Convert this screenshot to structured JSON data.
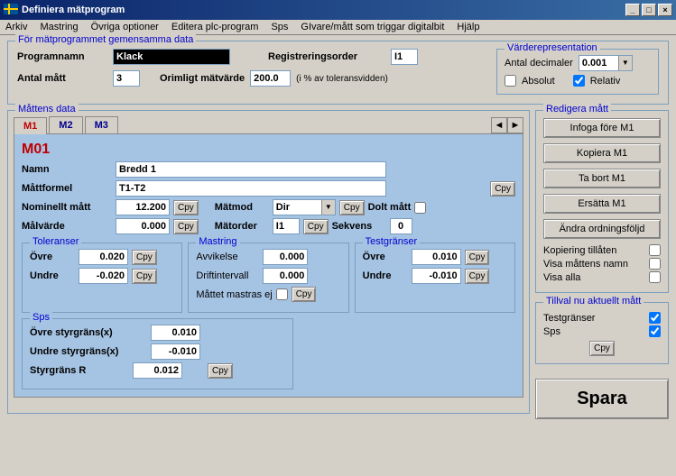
{
  "title": "Definiera mätprogram",
  "menu": [
    "Arkiv",
    "Mastring",
    "Övriga optioner",
    "Editera plc-program",
    "Sps",
    "GIvare/mått som triggar digitalbit",
    "Hjälp"
  ],
  "common": {
    "legend": "För mätprogrammet gemensamma data",
    "programnamn_lbl": "Programnamn",
    "programnamn": "Klack",
    "regorder_lbl": "Registreringsorder",
    "regorder": "I1",
    "antalmatt_lbl": "Antal mått",
    "antalmatt": "3",
    "orimligt_lbl": "Orimligt mätvärde",
    "orimligt": "200.0",
    "orimligt_hint": "(i % av toleransvidden)"
  },
  "valrep": {
    "legend": "Värderepresentation",
    "antaldec_lbl": "Antal decimaler",
    "antaldec": "0.001",
    "absolut_lbl": "Absolut",
    "relativ_lbl": "Relativ"
  },
  "mattens_legend": "Måttens data",
  "tabs": [
    "M1",
    "M2",
    "M3"
  ],
  "m": {
    "id": "M01",
    "namn_lbl": "Namn",
    "namn": "Bredd 1",
    "formel_lbl": "Måttformel",
    "formel": "T1-T2",
    "nominell_lbl": "Nominellt mått",
    "nominell": "12.200",
    "matmod_lbl": "Mätmod",
    "matmod": "Dir",
    "dolt_lbl": "Dolt mått",
    "malvarde_lbl": "Målvärde",
    "malvarde": "0.000",
    "matorder_lbl": "Mätorder",
    "matorder": "I1",
    "sekvens_lbl": "Sekvens",
    "sekvens": "0",
    "cpy": "Cpy"
  },
  "tol": {
    "legend": "Toleranser",
    "ovre_lbl": "Övre",
    "ovre": "0.020",
    "undre_lbl": "Undre",
    "undre": "-0.020"
  },
  "mast": {
    "legend": "Mastring",
    "avvik_lbl": "Avvikelse",
    "avvik": "0.000",
    "drift_lbl": "Driftintervall",
    "drift": "0.000",
    "mastras_lbl": "Måttet mastras ej"
  },
  "test": {
    "legend": "Testgränser",
    "ovre_lbl": "Övre",
    "ovre": "0.010",
    "undre_lbl": "Undre",
    "undre": "-0.010"
  },
  "sps": {
    "legend": "Sps",
    "ovre_lbl": "Övre styrgräns(x)",
    "ovre": "0.010",
    "undre_lbl": "Undre styrgräns(x)",
    "undre": "-0.010",
    "r_lbl": "Styrgräns R",
    "r": "0.012"
  },
  "edit": {
    "legend": "Redigera mått",
    "b1": "Infoga före M1",
    "b2": "Kopiera M1",
    "b3": "Ta bort M1",
    "b4": "Ersätta M1",
    "b5": "Ändra ordningsföljd",
    "c1": "Kopiering tillåten",
    "c2": "Visa måttens namn",
    "c3": "Visa alla"
  },
  "tillval": {
    "legend": "Tillval nu aktuellt mått",
    "c1": "Testgränser",
    "c2": "Sps"
  },
  "spara": "Spara"
}
